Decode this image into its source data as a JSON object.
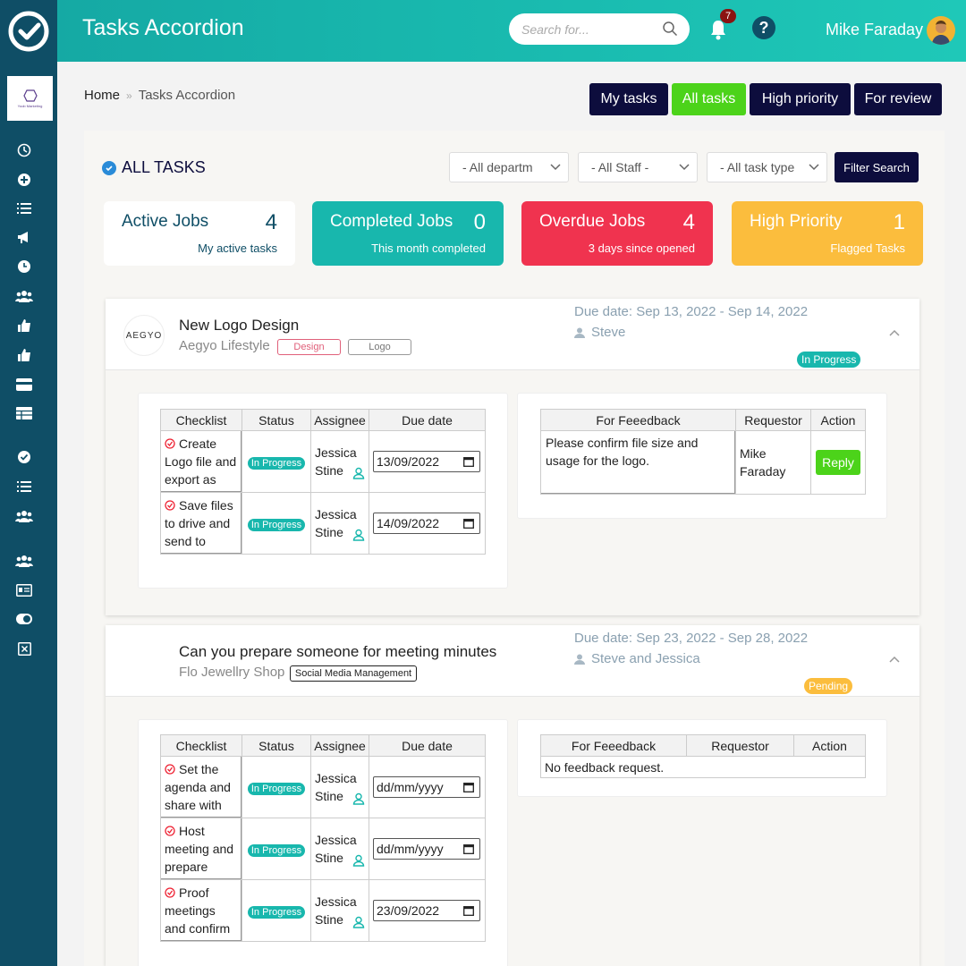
{
  "header": {
    "title": "Tasks Accordion",
    "search_placeholder": "Search for...",
    "notification_count": "7",
    "help_label": "?",
    "user_name": "Mike Faraday"
  },
  "sidebar": {
    "brand_text": "Yoob Marketing",
    "icons": [
      "clock-icon",
      "plus-circle-icon",
      "list-icon",
      "megaphone-icon",
      "time-icon",
      "users-icon",
      "thumbs-up-icon",
      "thumbs-up-icon",
      "card-icon",
      "table-icon",
      "check-circle-icon",
      "list-icon",
      "users-icon",
      "users-icon",
      "id-card-icon",
      "toggle-icon",
      "close-box-icon"
    ]
  },
  "breadcrumb": {
    "home": "Home",
    "separator": "»",
    "current": "Tasks Accordion"
  },
  "tabs": [
    "My tasks",
    "All tasks",
    "High priority",
    "For review"
  ],
  "filters": {
    "title": "ALL TASKS",
    "department": "- All departm",
    "staff": "- All Staff -",
    "task_type": "- All task type",
    "search_button": "Filter Search"
  },
  "cards": [
    {
      "label": "Active Jobs",
      "count": "4",
      "sub": "My active tasks",
      "color": "#ffffff"
    },
    {
      "label": "Completed Jobs",
      "count": "0",
      "sub": "This month completed",
      "color": "#18b7ad"
    },
    {
      "label": "Overdue Jobs",
      "count": "4",
      "sub": "3 days since opened",
      "color": "#f0334f"
    },
    {
      "label": "High Priority",
      "count": "1",
      "sub": "Flagged Tasks",
      "color": "#fbbd3d"
    }
  ],
  "tasks": [
    {
      "logo_text": "AEGYO",
      "title": "New Logo Design",
      "client": "Aegyo Lifestyle",
      "tags": [
        "Design",
        "Logo"
      ],
      "due": "Due date: Sep 13, 2022 - Sep 14, 2022",
      "assigned": "Steve",
      "status": "In Progress",
      "checklist_headers": [
        "Checklist",
        "Status",
        "Assignee",
        "Due date"
      ],
      "checklist": [
        {
          "text": "Create Logo file and export as required",
          "status": "In Progress",
          "assignee": "Jessica Stine",
          "date": "13/09/2022"
        },
        {
          "text": "Save files to drive and send to client",
          "status": "In Progress",
          "assignee": "Jessica Stine",
          "date": "14/09/2022"
        }
      ],
      "feedback_headers": [
        "For Feeedback",
        "Requestor",
        "Action"
      ],
      "feedback": [
        {
          "text": "Please confirm file size and usage for the logo.",
          "requestor": "Mike Faraday",
          "action": "Reply"
        }
      ]
    },
    {
      "logo_text": "",
      "title": "Can you prepare someone for meeting minutes",
      "client": "Flo Jewellry Shop",
      "tags": [
        "Social Media Management"
      ],
      "due": "Due date: Sep 23, 2022 - Sep 28, 2022",
      "assigned": "Steve and Jessica",
      "status": "Pending",
      "checklist_headers": [
        "Checklist",
        "Status",
        "Assignee",
        "Due date"
      ],
      "checklist": [
        {
          "text": "Set the agenda and share with all attendees",
          "status": "In Progress",
          "assignee": "Jessica Stine",
          "date": "dd/mm/yyyy"
        },
        {
          "text": "Host meeting and prepare minutes",
          "status": "In Progress",
          "assignee": "Jessica Stine",
          "date": "dd/mm/yyyy"
        },
        {
          "text": "Proof meetings and confirm with",
          "status": "In Progress",
          "assignee": "Jessica Stine",
          "date": "23/09/2022"
        }
      ],
      "feedback_headers": [
        "For Feeedback",
        "Requestor",
        "Action"
      ],
      "no_feedback": "No feedback request."
    }
  ]
}
